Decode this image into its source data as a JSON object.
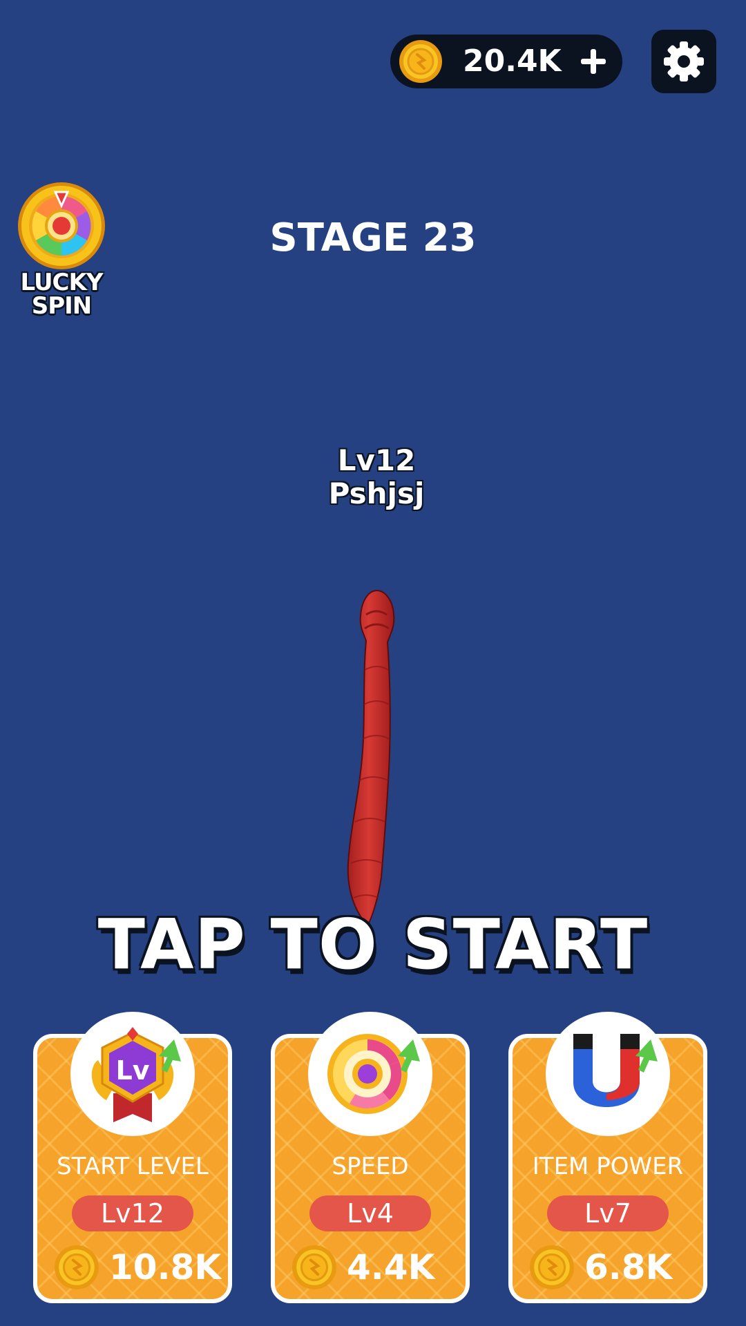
{
  "hud": {
    "coins": "20.4K",
    "plus_icon": "plus-icon",
    "settings_icon": "gear-icon"
  },
  "lucky_spin": {
    "label": "LUCKY\nSPIN",
    "icon": "spin-wheel-icon"
  },
  "stage": {
    "title": "STAGE 23"
  },
  "player": {
    "level": "Lv12",
    "name": "Pshjsj"
  },
  "prompt": "TAP TO START",
  "upgrades": [
    {
      "title": "START LEVEL",
      "level": "Lv12",
      "cost": "10.8K",
      "icon": "level-badge-icon"
    },
    {
      "title": "SPEED",
      "level": "Lv4",
      "cost": "4.4K",
      "icon": "speed-dial-icon"
    },
    {
      "title": "ITEM POWER",
      "level": "Lv7",
      "cost": "6.8K",
      "icon": "magnet-icon"
    }
  ],
  "colors": {
    "background": "#254181",
    "card": "#f6a32c",
    "level_pill": "#e4554a",
    "snake": "#c9302c",
    "coin": "#f7c21a"
  }
}
